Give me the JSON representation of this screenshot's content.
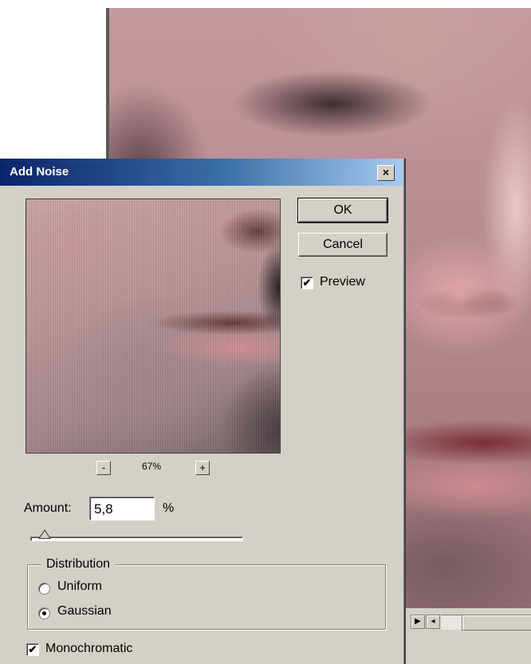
{
  "dialog": {
    "title": "Add Noise",
    "ok_label": "OK",
    "cancel_label": "Cancel",
    "preview_label": "Preview",
    "preview_checked": true,
    "zoom_minus": "-",
    "zoom_plus": "+",
    "zoom_level": "67%",
    "amount_label": "Amount:",
    "amount_value": "5,8",
    "amount_unit": "%",
    "distribution_label": "Distribution",
    "distribution_options": [
      "Uniform",
      "Gaussian"
    ],
    "distribution_selected": "Gaussian",
    "monochromatic_label": "Monochromatic",
    "monochromatic_checked": true,
    "close_glyph": "×"
  },
  "document": {
    "nav_right": "▶",
    "nav_left": "◂"
  },
  "colors": {
    "dialog_face": "#d4d0c8",
    "titlebar_start": "#0a246a",
    "titlebar_end": "#a6caf0"
  },
  "icons": {
    "close": "close-icon",
    "check": "checkmark-icon"
  }
}
